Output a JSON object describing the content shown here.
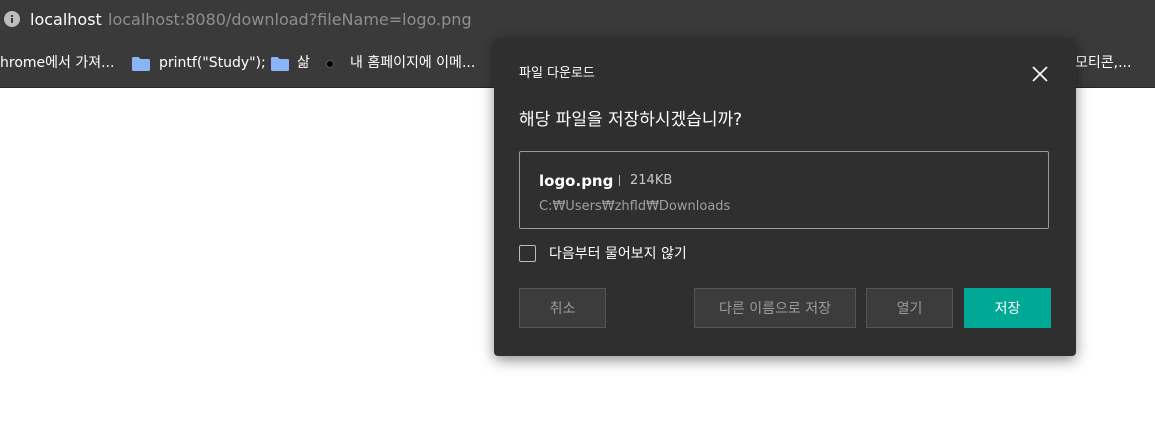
{
  "address_bar": {
    "host": "localhost",
    "url": "localhost:8080/download?fileName=logo.png"
  },
  "bookmarks": {
    "items": [
      {
        "label": "hrome에서 가져...",
        "icon": "none"
      },
      {
        "label": "printf(\"Study\");",
        "icon": "folder-icon"
      },
      {
        "label": "삶",
        "icon": "folder-icon"
      },
      {
        "label": "내 홈페이지에 이메...",
        "icon": "dot-icon"
      },
      {
        "label": "모티콘,...",
        "icon": "none"
      }
    ],
    "folder_color": "#8ab4f8"
  },
  "dialog": {
    "title": "파일 다운로드",
    "question": "해당 파일을 저장하시겠습니까?",
    "file": {
      "name": "logo.png",
      "size": "214KB",
      "path": "C:₩Users₩zhfld₩Downloads"
    },
    "checkbox": {
      "label": "다음부터 물어보지 않기",
      "checked": false
    },
    "buttons": {
      "cancel": "취소",
      "save_as": "다른 이름으로 저장",
      "open": "열기",
      "save": "저장"
    },
    "accent_color": "#00a896"
  }
}
